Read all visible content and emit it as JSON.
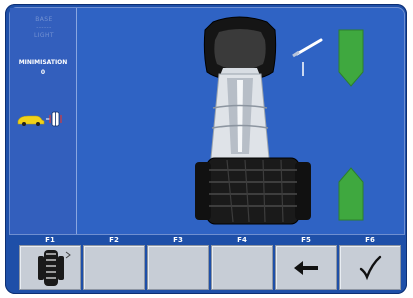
{
  "sidebar": {
    "faded_line1": "BASE",
    "faded_line2": "------",
    "faded_line3": "LIGHT",
    "block_title": "MINIMISATION",
    "block_value": "0",
    "car_icon": "car-wheel-icon"
  },
  "fkeys": [
    {
      "num": "F1",
      "icon": "tyre-icon"
    },
    {
      "num": "F2",
      "icon": ""
    },
    {
      "num": "F3",
      "icon": ""
    },
    {
      "num": "F4",
      "icon": ""
    },
    {
      "num": "F5",
      "icon": "arrow-left-icon"
    },
    {
      "num": "F6",
      "icon": "checkmark-icon"
    }
  ],
  "colors": {
    "background": "#2f63c4",
    "arrow_green": "#3fa83f",
    "panel": "#1e4fa8"
  }
}
